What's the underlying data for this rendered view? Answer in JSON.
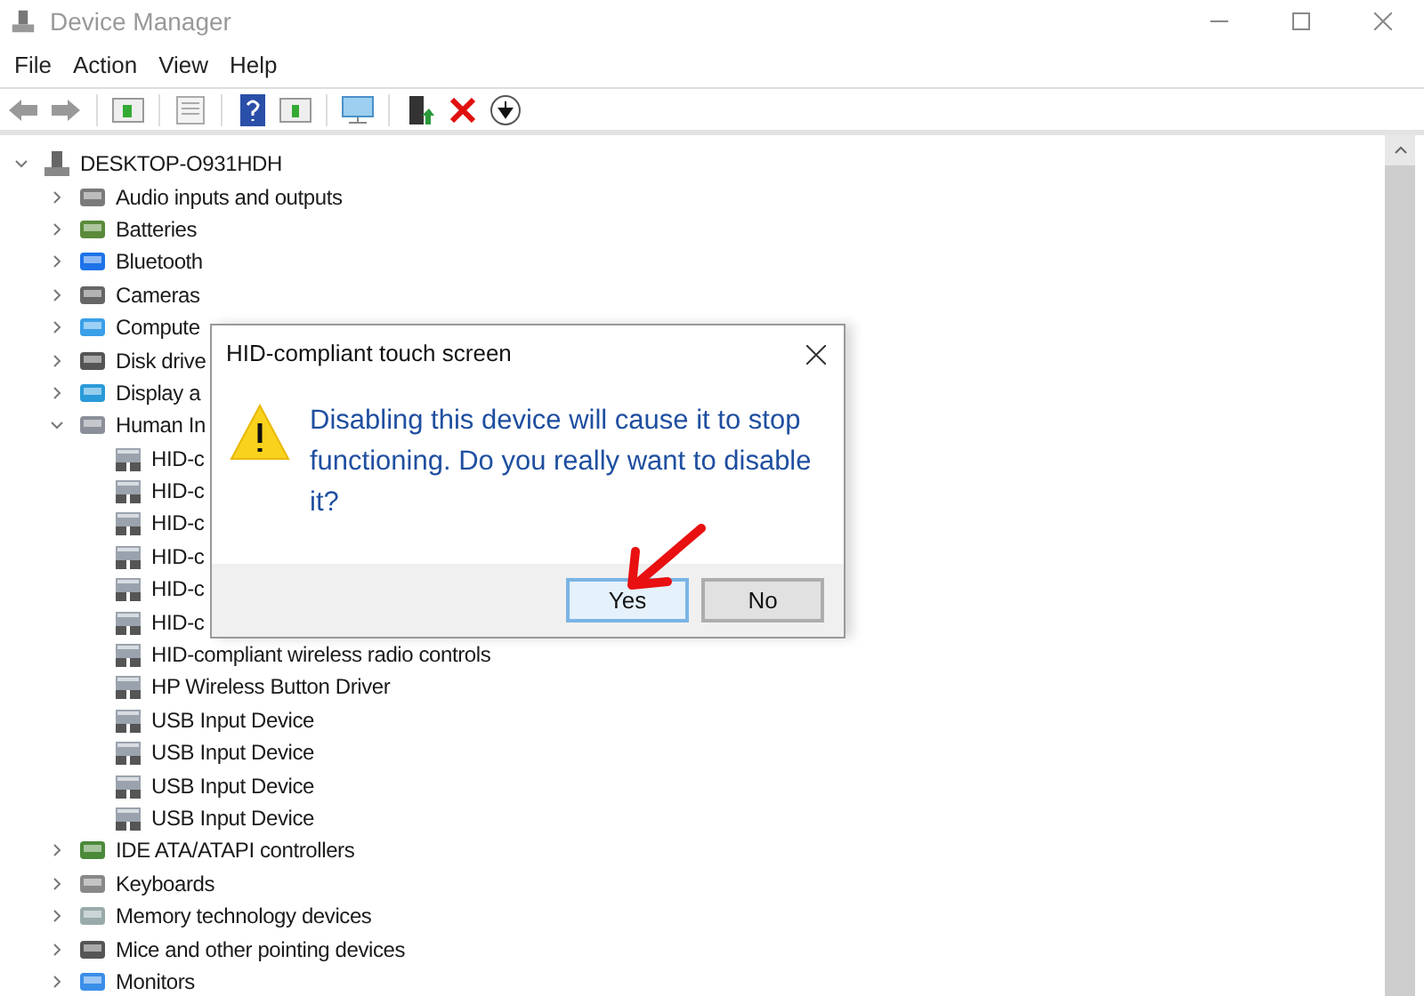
{
  "window": {
    "title": "Device Manager"
  },
  "menu": [
    "File",
    "Action",
    "View",
    "Help"
  ],
  "tree": [
    {
      "label": "DESKTOP-O931HDH",
      "expanded": true,
      "children": [
        {
          "label": "Audio inputs and outputs",
          "expanded": false
        },
        {
          "label": "Batteries",
          "expanded": false
        },
        {
          "label": "Bluetooth",
          "expanded": false
        },
        {
          "label": "Cameras",
          "expanded": false
        },
        {
          "label": "Compute",
          "expanded": false
        },
        {
          "label": "Disk drive",
          "expanded": false
        },
        {
          "label": "Display a",
          "expanded": false
        },
        {
          "label": "Human In",
          "expanded": true,
          "children": [
            {
              "label": "HID-c"
            },
            {
              "label": "HID-c"
            },
            {
              "label": "HID-c"
            },
            {
              "label": "HID-c"
            },
            {
              "label": "HID-c"
            },
            {
              "label": "HID-c"
            },
            {
              "label": "HID-compliant wireless radio controls"
            },
            {
              "label": "HP Wireless Button Driver"
            },
            {
              "label": "USB Input Device"
            },
            {
              "label": "USB Input Device"
            },
            {
              "label": "USB Input Device"
            },
            {
              "label": "USB Input Device"
            }
          ]
        },
        {
          "label": "IDE ATA/ATAPI controllers",
          "expanded": false
        },
        {
          "label": "Keyboards",
          "expanded": false
        },
        {
          "label": "Memory technology devices",
          "expanded": false
        },
        {
          "label": "Mice and other pointing devices",
          "expanded": false
        },
        {
          "label": "Monitors",
          "expanded": false
        }
      ]
    }
  ],
  "dialog": {
    "title": "HID-compliant touch screen",
    "message": "Disabling this device will cause it to stop functioning. Do you really want to disable it?",
    "buttons": [
      {
        "label": "Yes",
        "selected": true
      },
      {
        "label": "No",
        "selected": false
      }
    ]
  }
}
